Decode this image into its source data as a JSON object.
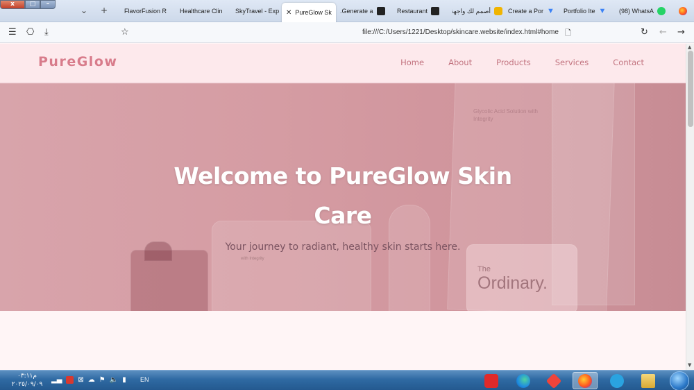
{
  "browser": {
    "window_buttons": [
      "x",
      "□",
      "–"
    ],
    "tabs": [
      {
        "label": "FlavorFusion Re",
        "icon": "blank-favicon",
        "active": false
      },
      {
        "label": "Healthcare Clini",
        "icon": "blank-favicon",
        "active": false
      },
      {
        "label": "SkyTravel - Explo",
        "icon": "blank-favicon",
        "active": false
      },
      {
        "label": "PureGlow Sk",
        "icon": "close-icon",
        "active": true
      },
      {
        "label": ".Generate a",
        "icon": "chatgpt-icon",
        "active": false
      },
      {
        "label": "Restaurant",
        "icon": "blank-favicon",
        "active": false
      },
      {
        "label": "أصمم لك واجهة",
        "icon": "ai-icon",
        "active": false
      },
      {
        "label": "Create a Por",
        "icon": "blank-favicon",
        "active": false
      },
      {
        "label": "Portfolio Ite",
        "icon": "v-icon",
        "active": false
      },
      {
        "label": "(98) WhatsA",
        "icon": "whatsapp-icon",
        "active": false
      }
    ],
    "url": "file:///C:/Users/1221/Desktop/skincare.website/index.html#home"
  },
  "site": {
    "logo": "PureGlow",
    "nav": [
      "Home",
      "About",
      "Products",
      "Services",
      "Contact"
    ],
    "hero_title_line1": "Welcome to PureGlow Skin",
    "hero_title_line2": "Care",
    "hero_subtitle": "Your journey to radiant, healthy skin starts here.",
    "product_brand_the": "The",
    "product_brand": "Ordinary.",
    "tube_text": "Glycolic Acid Solution with Integrity",
    "cream_text": "with Integrity"
  },
  "taskbar": {
    "time": "م٠٣:١١",
    "date": "٢٠٢٥/٠٩/٠٩",
    "language": "EN",
    "apps": [
      "wps-icon",
      "edge-icon",
      "anydesk-icon",
      "firefox-icon",
      "telegram-icon",
      "explorer-icon"
    ]
  },
  "colors": {
    "header_bg": "#fde9ec",
    "logo": "#d87c8b",
    "nav": "#c2737f",
    "hero_overlay": "#d59ca3",
    "hero_title": "#ffffff",
    "hero_subtitle": "#7a5360"
  }
}
